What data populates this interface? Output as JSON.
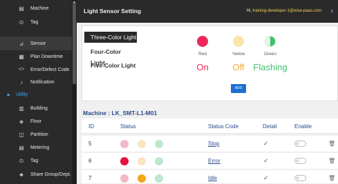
{
  "sidebar": {
    "items": [
      {
        "label": "Machine",
        "icon": "machine-icon",
        "glyph": "▤"
      },
      {
        "label": "Tag",
        "icon": "tag-icon",
        "glyph": "⊙"
      },
      {
        "label": "Sensor",
        "icon": "sensor-icon",
        "glyph": "⊿"
      },
      {
        "label": "Plan Downtime",
        "icon": "calendar-icon",
        "glyph": "▦"
      },
      {
        "label": "Error/Defect Code",
        "icon": "code-icon",
        "glyph": "</>"
      },
      {
        "label": "Notification",
        "icon": "bell-icon",
        "glyph": "♪"
      },
      {
        "label": "Utility",
        "icon": "utility-icon",
        "glyph": "●"
      },
      {
        "label": "Building",
        "icon": "building-icon",
        "glyph": "▥"
      },
      {
        "label": "Floor",
        "icon": "floor-icon",
        "glyph": "◈"
      },
      {
        "label": "Partition",
        "icon": "partition-icon",
        "glyph": "◫"
      },
      {
        "label": "Metering",
        "icon": "metering-icon",
        "glyph": "▤"
      },
      {
        "label": "Tag",
        "icon": "tag-icon",
        "glyph": "⊙"
      },
      {
        "label": "Share Group/Dept.",
        "icon": "group-icon",
        "glyph": "♣"
      }
    ]
  },
  "header": {
    "title": "Light Sensor Setting",
    "greeting": "Hi, ",
    "user": "training-developer-1@wise-paas.com"
  },
  "light_types": [
    "Three-Color Light",
    "Four-Color Light",
    "Five-Color Light"
  ],
  "lights": [
    {
      "name": "Red",
      "state": "On",
      "color": "#f0285a",
      "state_color": "#e8284a"
    },
    {
      "name": "Yellow",
      "state": "Off",
      "color": "#f9e4ab",
      "state_color": "#f4a93a"
    },
    {
      "name": "Green",
      "state": "Flashing",
      "color": "#3fbf6a",
      "state_color": "#3fbf6a"
    }
  ],
  "add_label": "ADD",
  "machine": "Machine : LK_SMT-L1-M01",
  "table": {
    "headers": [
      "ID",
      "Status",
      "Status Code",
      "Detail",
      "Enable"
    ],
    "rows": [
      {
        "id": "5",
        "code": "Stop",
        "dots": [
          "#f4b8c4",
          "#f9e4c4",
          "#bfe6cf"
        ]
      },
      {
        "id": "6",
        "code": "Error",
        "dots": [
          "#e8123e",
          "#f9e4c4",
          "#bfe6cf"
        ]
      },
      {
        "id": "7",
        "code": "Idle",
        "dots": [
          "#f4b8c4",
          "#f3a51d",
          "#bfe6cf"
        ]
      }
    ]
  },
  "colors": {
    "sidebar_bg": "#2a2a2a",
    "accent": "#1d6fd0",
    "link": "#2a4a8a"
  }
}
